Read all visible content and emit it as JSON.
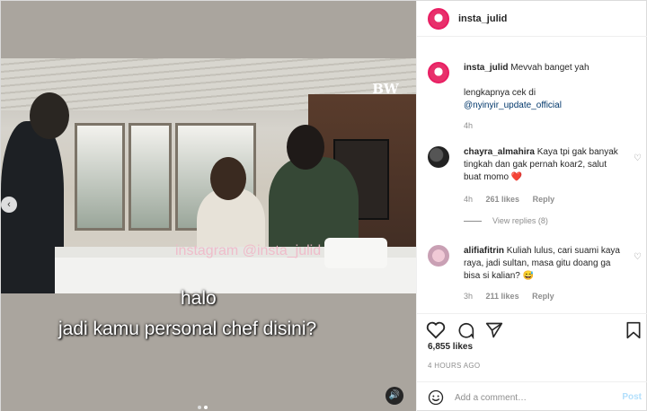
{
  "post": {
    "username": "insta_julid",
    "logo_text": "BW",
    "watermark": "instagram @insta_julid",
    "subtitle_line1": "halo",
    "subtitle_line2": "jadi kamu personal chef disini?",
    "carousel": {
      "count": 2,
      "active": 1
    }
  },
  "caption": {
    "username": "insta_julid",
    "text": "Mevvah banget yah",
    "line2": "lengkapnya cek di",
    "mention": "@nyinyir_update_official",
    "time": "4h"
  },
  "comments": [
    {
      "username": "chayra_almahira",
      "text": "Kaya tpi gak banyak tingkah dan gak pernah koar2, salut buat momo",
      "emoji": "❤️",
      "time": "4h",
      "likes": "261 likes",
      "reply": "Reply",
      "view_replies": "View replies (8)"
    },
    {
      "username": "alifiafitrin",
      "text": "Kuliah lulus, cari suami kaya raya, jadi sultan, masa gitu doang ga bisa si kalian?",
      "emoji": "😅",
      "time": "3h",
      "likes": "211 likes",
      "reply": "Reply"
    }
  ],
  "stats": {
    "likes": "6,855 likes",
    "ago": "4 HOURS AGO"
  },
  "comment_box": {
    "placeholder": "Add a comment…",
    "post_label": "Post"
  },
  "icons": {
    "heart": "heart-icon",
    "comment": "comment-icon",
    "share": "share-icon",
    "save": "bookmark-icon",
    "emoji": "emoji-icon",
    "sound": "speaker-icon",
    "prev": "chevron-left-icon"
  },
  "colors": {
    "link": "#00376b",
    "muted": "#8e8e8e",
    "post_disabled": "#b2dffc",
    "avatar_ring": "#e91e63"
  }
}
